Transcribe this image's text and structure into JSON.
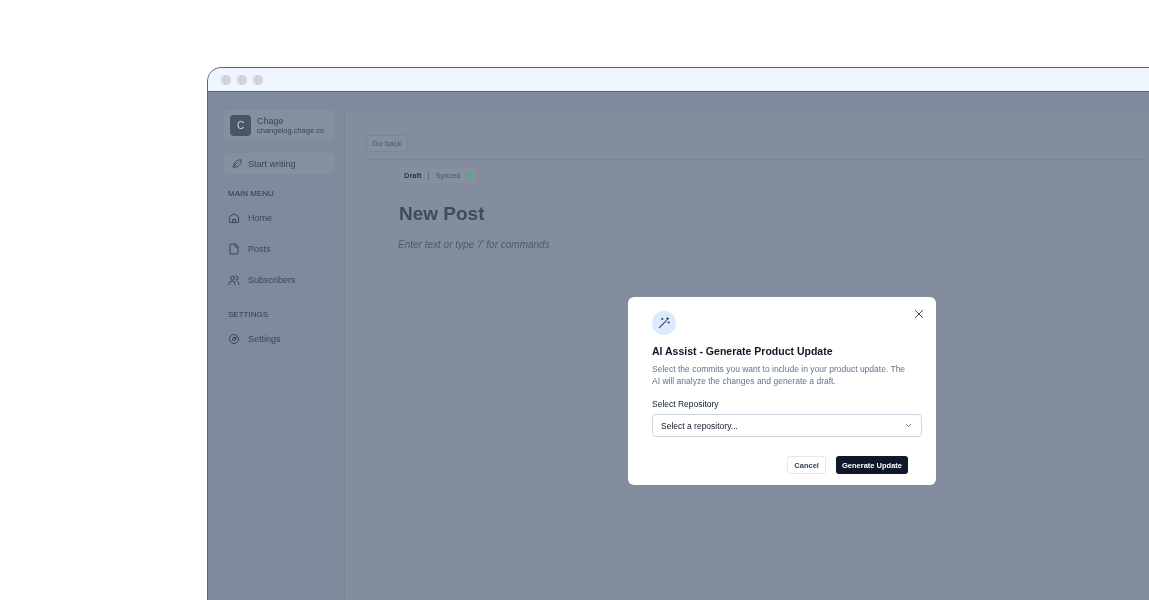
{
  "sidebar": {
    "org": {
      "initial": "C",
      "name": "Chage",
      "domain": "changelog.chage.co"
    },
    "start_button": "Start writing",
    "sections": [
      {
        "label": "MAIN MENU",
        "items": [
          {
            "label": "Home"
          },
          {
            "label": "Posts"
          },
          {
            "label": "Subscribers"
          }
        ]
      },
      {
        "label": "SETTINGS",
        "items": [
          {
            "label": "Settings"
          }
        ]
      }
    ]
  },
  "editor": {
    "back_button": "Go back",
    "status": {
      "state": "Draft",
      "separator": "|",
      "sync": "Synced",
      "color": "#22c55e"
    },
    "title": "New Post",
    "placeholder": "Enter text or type '/' for commands"
  },
  "dialog": {
    "title": "AI Assist - Generate Product Update",
    "description": "Select the commits you want to include in your product update. The AI will analyze the changes and generate a draft.",
    "field_label": "Select Repository",
    "select_placeholder": "Select a repository...",
    "buttons": [
      "Cancel",
      "Generate Update"
    ]
  }
}
